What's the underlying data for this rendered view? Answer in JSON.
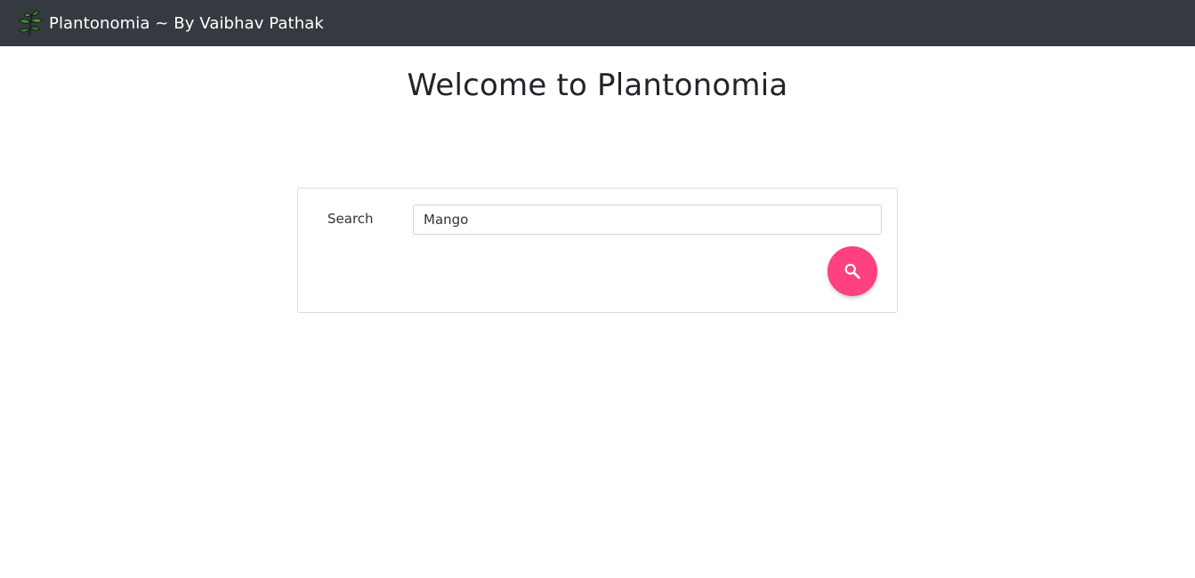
{
  "navbar": {
    "brand_text": "Plantonomia ~ By Vaibhav Pathak",
    "logo_icon": "plant-icon",
    "background": "#343a40"
  },
  "main": {
    "title": "Welcome to Plantonomia"
  },
  "search": {
    "label": "Search",
    "value": "Mango",
    "button_icon": "search-icon",
    "button_color": "#ff4081"
  }
}
